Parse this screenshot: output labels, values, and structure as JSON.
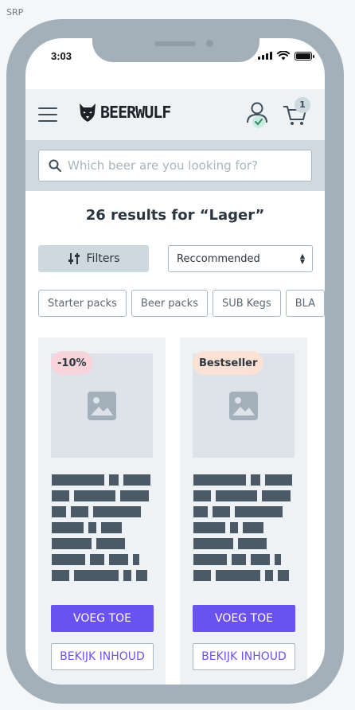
{
  "frame_label": "SRP",
  "status_bar": {
    "time": "3:03"
  },
  "header": {
    "logo_text": "BEERWULF",
    "cart_count": "1",
    "icons": [
      "menu-icon",
      "wolf-logo-icon",
      "user-check-icon",
      "cart-icon"
    ]
  },
  "search": {
    "placeholder": "Which beer are you looking for?",
    "value": ""
  },
  "results": {
    "title": "26 results for “Lager”"
  },
  "toolbar": {
    "filters_label": "Filters",
    "sort_selected": "Reccommended"
  },
  "chips": [
    "Starter packs",
    "Beer packs",
    "SUB Kegs",
    "BLA"
  ],
  "products": [
    {
      "badge": "-10%",
      "add_label": "VOEG TOE",
      "view_label": "BEKIJK INHOUD"
    },
    {
      "badge": "Bestseller",
      "add_label": "VOEG TOE",
      "view_label": "BEKIJK INHOUD"
    }
  ],
  "colors": {
    "accent": "#6a52f2",
    "discount_badge": "#f7d4d9",
    "bestseller_badge": "#fbe2d4",
    "phone_frame": "#a3b0ba",
    "header_bg": "#eff2f5"
  }
}
